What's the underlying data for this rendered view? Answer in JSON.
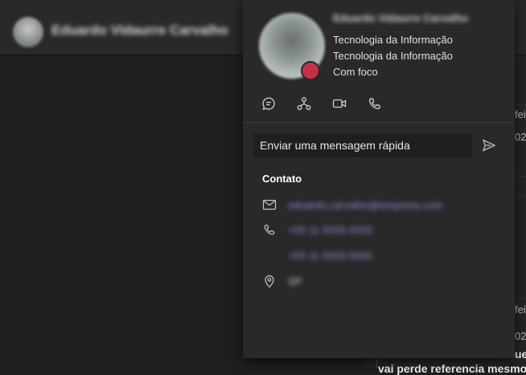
{
  "header": {
    "chat_name": "Eduardo Vidaurre Carvalho"
  },
  "profile_card": {
    "name": "Eduardo Vidaurre Carvalho",
    "department": "Tecnologia da Informação",
    "job_title": "Tecnologia da Informação",
    "status": "Com foco",
    "presence_color": "#c4314b",
    "actions": [
      "chat-icon",
      "org-chart-icon",
      "video-call-icon",
      "phone-icon"
    ],
    "quick_message_placeholder": "Enviar uma mensagem rápida",
    "contact_section_title": "Contato",
    "email": "eduardo.carvalho@empresa.com",
    "phone": "+55 11 5555-5555",
    "mobile": "+55 11 5555-5555",
    "location": "SP"
  },
  "right_column": {
    "day_top": "feir",
    "time_top": "02",
    "day_bottom": "feir",
    "time_bottom": "02",
    "snippet_top": "ue",
    "snippet_bottom": "vai perde referencia mesmo"
  },
  "colors": {
    "accent": "#8e8eda",
    "card_bg": "#292929",
    "app_bg": "#1f1f1f"
  }
}
